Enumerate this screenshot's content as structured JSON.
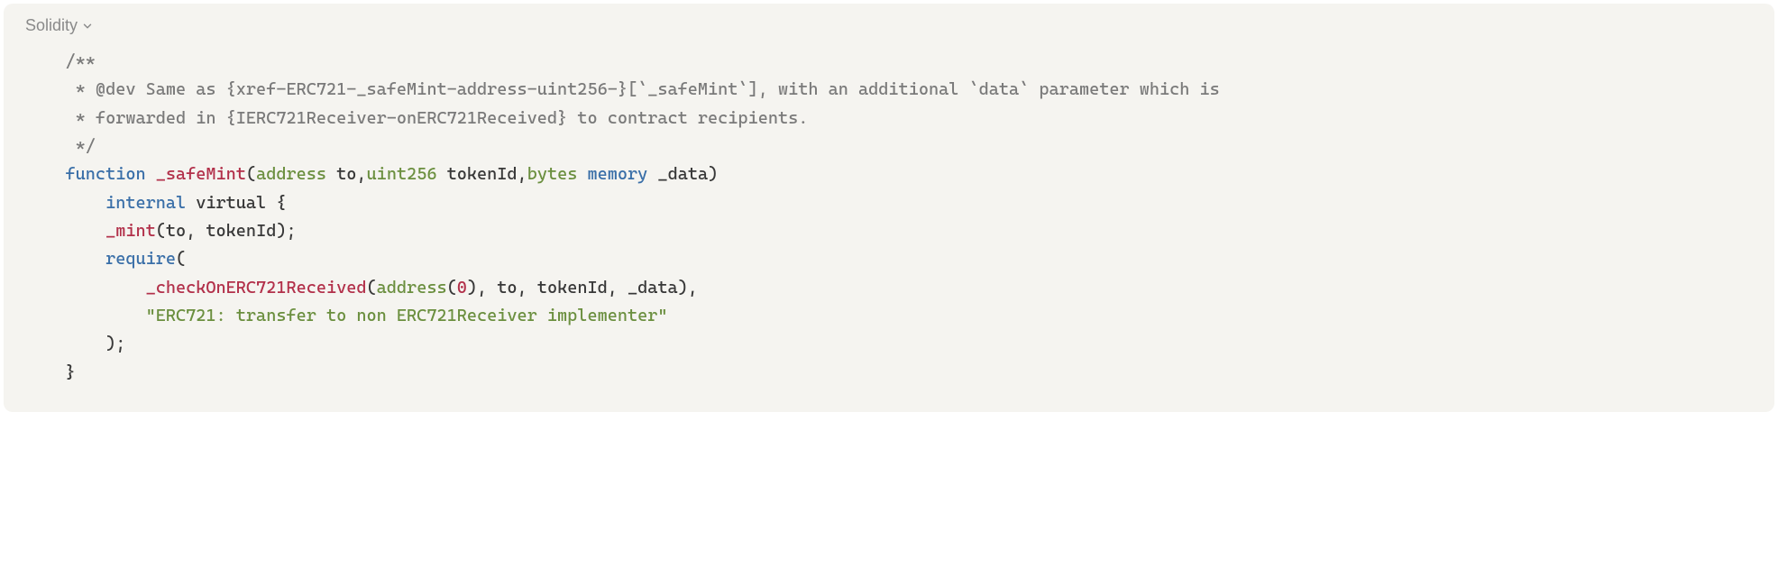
{
  "language": "Solidity",
  "code": {
    "comment1": "/**",
    "comment2": " * @dev Same as {xref-ERC721-_safeMint-address-uint256-}[`_safeMint`], with an additional `data` parameter which is",
    "comment3": " * forwarded in {IERC721Receiver-onERC721Received} to contract recipients.",
    "comment4": " */",
    "kw_function": "function",
    "fn_safeMint": "_safeMint",
    "type_address": "address",
    "param_to": " to,",
    "type_uint256": "uint256",
    "param_tokenId": " tokenId,",
    "type_bytes": "bytes",
    "kw_memory": "memory",
    "param_data": " _data)",
    "kw_internal": "internal",
    "kw_virtual": " virtual {",
    "fn_mint": "_mint",
    "mint_args": "(to, tokenId);",
    "kw_require": "require",
    "require_open": "(",
    "fn_check": "_checkOnERC721Received",
    "check_open": "(",
    "type_address2": "address",
    "check_args1": "(",
    "num_zero": "0",
    "check_args2": "), to, tokenId, _data),",
    "str_err": "\"ERC721: transfer to non ERC721Receiver implementer\"",
    "require_close": ");",
    "fn_close": "}"
  }
}
